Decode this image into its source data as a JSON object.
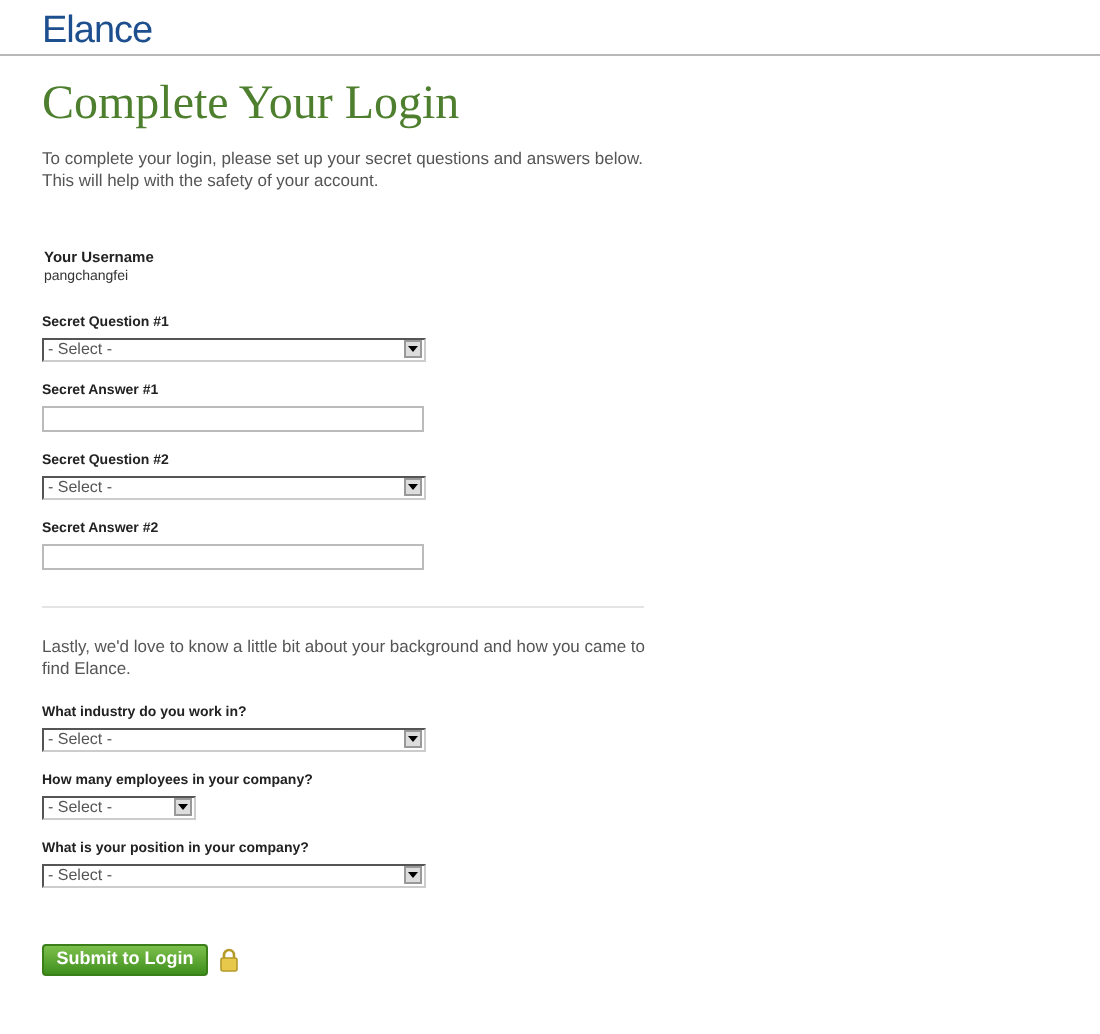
{
  "logo": "Elance",
  "title": "Complete Your Login",
  "intro": "To complete your login, please set up your secret questions and answers below. This will help with the safety of your account.",
  "username": {
    "label": "Your Username",
    "value": "pangchangfei"
  },
  "security_fields": [
    {
      "label": "Secret Question #1",
      "kind": "select",
      "value": "- Select -"
    },
    {
      "label": "Secret Answer #1",
      "kind": "text"
    },
    {
      "label": "Secret Question #2",
      "kind": "select",
      "value": "- Select -"
    },
    {
      "label": "Secret Answer #2",
      "kind": "text"
    }
  ],
  "background_intro": "Lastly, we'd love to know a little bit about your background and how you came to find Elance.",
  "background_fields": [
    {
      "label": "What industry do you work in?",
      "kind": "select",
      "value": "- Select -"
    },
    {
      "label": "How many employees in your company?",
      "kind": "short_select",
      "value": "- Select -"
    },
    {
      "label": "What is your position in your company?",
      "kind": "select",
      "value": "- Select -"
    }
  ],
  "submit_button": "Submit to Login"
}
